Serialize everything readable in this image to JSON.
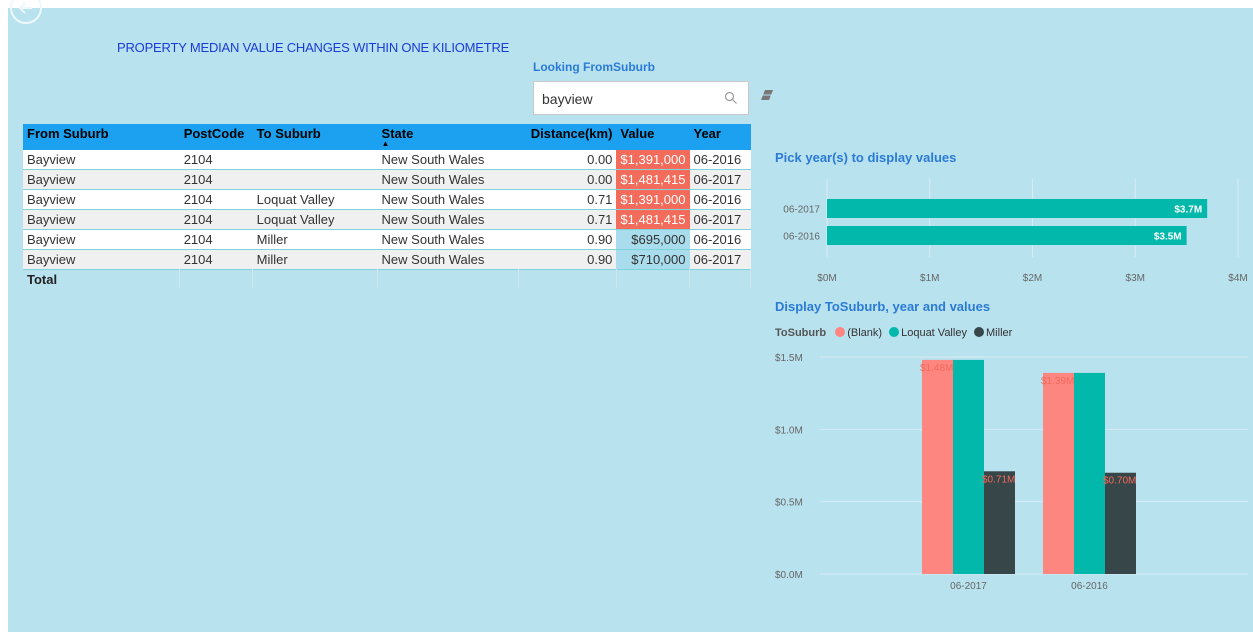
{
  "report": {
    "title": "PROPERTY MEDIAN VALUE CHANGES WITHIN ONE KILIOMETRE"
  },
  "slicer": {
    "title": "Looking FromSuburb",
    "value": "bayview"
  },
  "table": {
    "columns": [
      "From Suburb",
      "PostCode",
      "To Suburb",
      "State",
      "Distance(km)",
      "Value",
      "Year"
    ],
    "rows": [
      {
        "from": "Bayview",
        "postcode": "2104",
        "to": "",
        "state": "New South Wales",
        "distance": "0.00",
        "value": "$1,391,000",
        "year": "06-2016",
        "level": "hi"
      },
      {
        "from": "Bayview",
        "postcode": "2104",
        "to": "",
        "state": "New South Wales",
        "distance": "0.00",
        "value": "$1,481,415",
        "year": "06-2017",
        "level": "hi"
      },
      {
        "from": "Bayview",
        "postcode": "2104",
        "to": "Loquat Valley",
        "state": "New South Wales",
        "distance": "0.71",
        "value": "$1,391,000",
        "year": "06-2016",
        "level": "hi"
      },
      {
        "from": "Bayview",
        "postcode": "2104",
        "to": "Loquat Valley",
        "state": "New South Wales",
        "distance": "0.71",
        "value": "$1,481,415",
        "year": "06-2017",
        "level": "hi"
      },
      {
        "from": "Bayview",
        "postcode": "2104",
        "to": "Miller",
        "state": "New South Wales",
        "distance": "0.90",
        "value": "$695,000",
        "year": "06-2016",
        "level": "lo"
      },
      {
        "from": "Bayview",
        "postcode": "2104",
        "to": "Miller",
        "state": "New South Wales",
        "distance": "0.90",
        "value": "$710,000",
        "year": "06-2017",
        "level": "lo"
      }
    ],
    "total_label": "Total"
  },
  "colors": {
    "blank": "#fd8680",
    "loquat": "#01b8aa",
    "miller": "#374649",
    "header": "#1ca1f0",
    "value_high": "#f26b5b",
    "value_low": "#a9dcec"
  },
  "chart_data": [
    {
      "type": "bar",
      "orientation": "horizontal",
      "title": "Pick year(s) to display values",
      "categories": [
        "06-2017",
        "06-2016"
      ],
      "values": [
        3.7,
        3.5
      ],
      "data_labels": [
        "$3.7M",
        "$3.5M"
      ],
      "xlim": [
        0,
        4
      ],
      "xticks": [
        "$0M",
        "$1M",
        "$2M",
        "$3M",
        "$4M"
      ],
      "color": "#01b8aa",
      "grid": true
    },
    {
      "type": "bar",
      "title": "Display ToSuburb, year and values",
      "legend_title": "ToSuburb",
      "legend_position": "top-left",
      "categories": [
        "06-2017",
        "06-2016"
      ],
      "series": [
        {
          "name": "(Blank)",
          "values": [
            1.48,
            1.39
          ],
          "color": "#fd8680"
        },
        {
          "name": "Loquat Valley",
          "values": [
            1.48,
            1.39
          ],
          "color": "#01b8aa"
        },
        {
          "name": "Miller",
          "values": [
            0.71,
            0.7
          ],
          "color": "#374649"
        }
      ],
      "data_labels": [
        {
          "series": 0,
          "category": 0,
          "text": "$1.48M"
        },
        {
          "series": 0,
          "category": 1,
          "text": "$1.39M"
        },
        {
          "series": 2,
          "category": 0,
          "text": "$0.71M"
        },
        {
          "series": 2,
          "category": 1,
          "text": "$0.70M"
        }
      ],
      "ylim": [
        0,
        1.5
      ],
      "yticks": [
        "$0.0M",
        "$0.5M",
        "$1.0M",
        "$1.5M"
      ],
      "grid": true
    }
  ]
}
